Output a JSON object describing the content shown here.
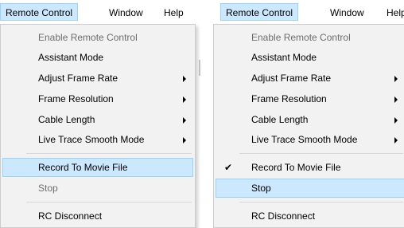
{
  "left": {
    "menubar": {
      "remote_control": "Remote Control",
      "window": "Window",
      "help": "Help"
    },
    "menu": {
      "enable_remote_control": "Enable Remote Control",
      "assistant_mode": "Assistant Mode",
      "adjust_frame_rate": "Adjust Frame Rate",
      "frame_resolution": "Frame Resolution",
      "cable_length": "Cable Length",
      "live_trace_smooth_mode": "Live Trace Smooth Mode",
      "record_to_movie_file": "Record To Movie File",
      "stop": "Stop",
      "rc_disconnect": "RC Disconnect"
    }
  },
  "right": {
    "menubar": {
      "remote_control": "Remote Control",
      "window": "Window",
      "help": "Help"
    },
    "menu": {
      "enable_remote_control": "Enable Remote Control",
      "assistant_mode": "Assistant Mode",
      "adjust_frame_rate": "Adjust Frame Rate",
      "frame_resolution": "Frame Resolution",
      "cable_length": "Cable Length",
      "live_trace_smooth_mode": "Live Trace Smooth Mode",
      "record_to_movie_file": "Record To Movie File",
      "record_checkmark": "✔",
      "stop": "Stop",
      "rc_disconnect": "RC Disconnect"
    }
  },
  "colors": {
    "highlight": "#cce8ff",
    "highlight_border": "#99d1ff",
    "menu_background": "#f2f2f2",
    "disabled_text": "#6d6d6d"
  }
}
